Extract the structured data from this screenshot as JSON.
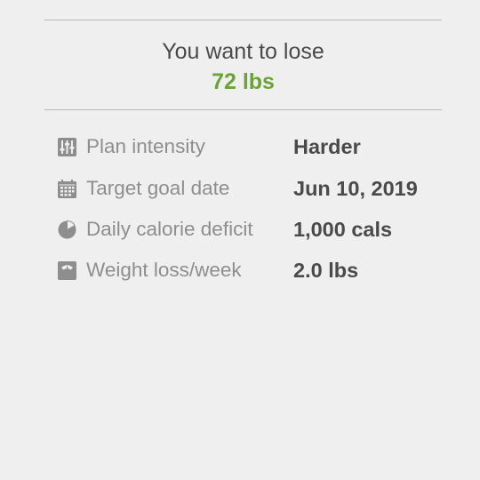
{
  "goal": {
    "title": "You want to lose",
    "amount": "72 lbs",
    "accent_color": "#6aa436"
  },
  "plan": {
    "rows": [
      {
        "icon": "sliders-icon",
        "label": "Plan intensity",
        "value": "Harder"
      },
      {
        "icon": "calendar-icon",
        "label": "Target goal date",
        "value": "Jun 10, 2019"
      },
      {
        "icon": "pie-chart-icon",
        "label": "Daily calorie deficit",
        "value": "1,000 cals"
      },
      {
        "icon": "scale-icon",
        "label": "Weight loss/week",
        "value": "2.0 lbs"
      }
    ]
  }
}
